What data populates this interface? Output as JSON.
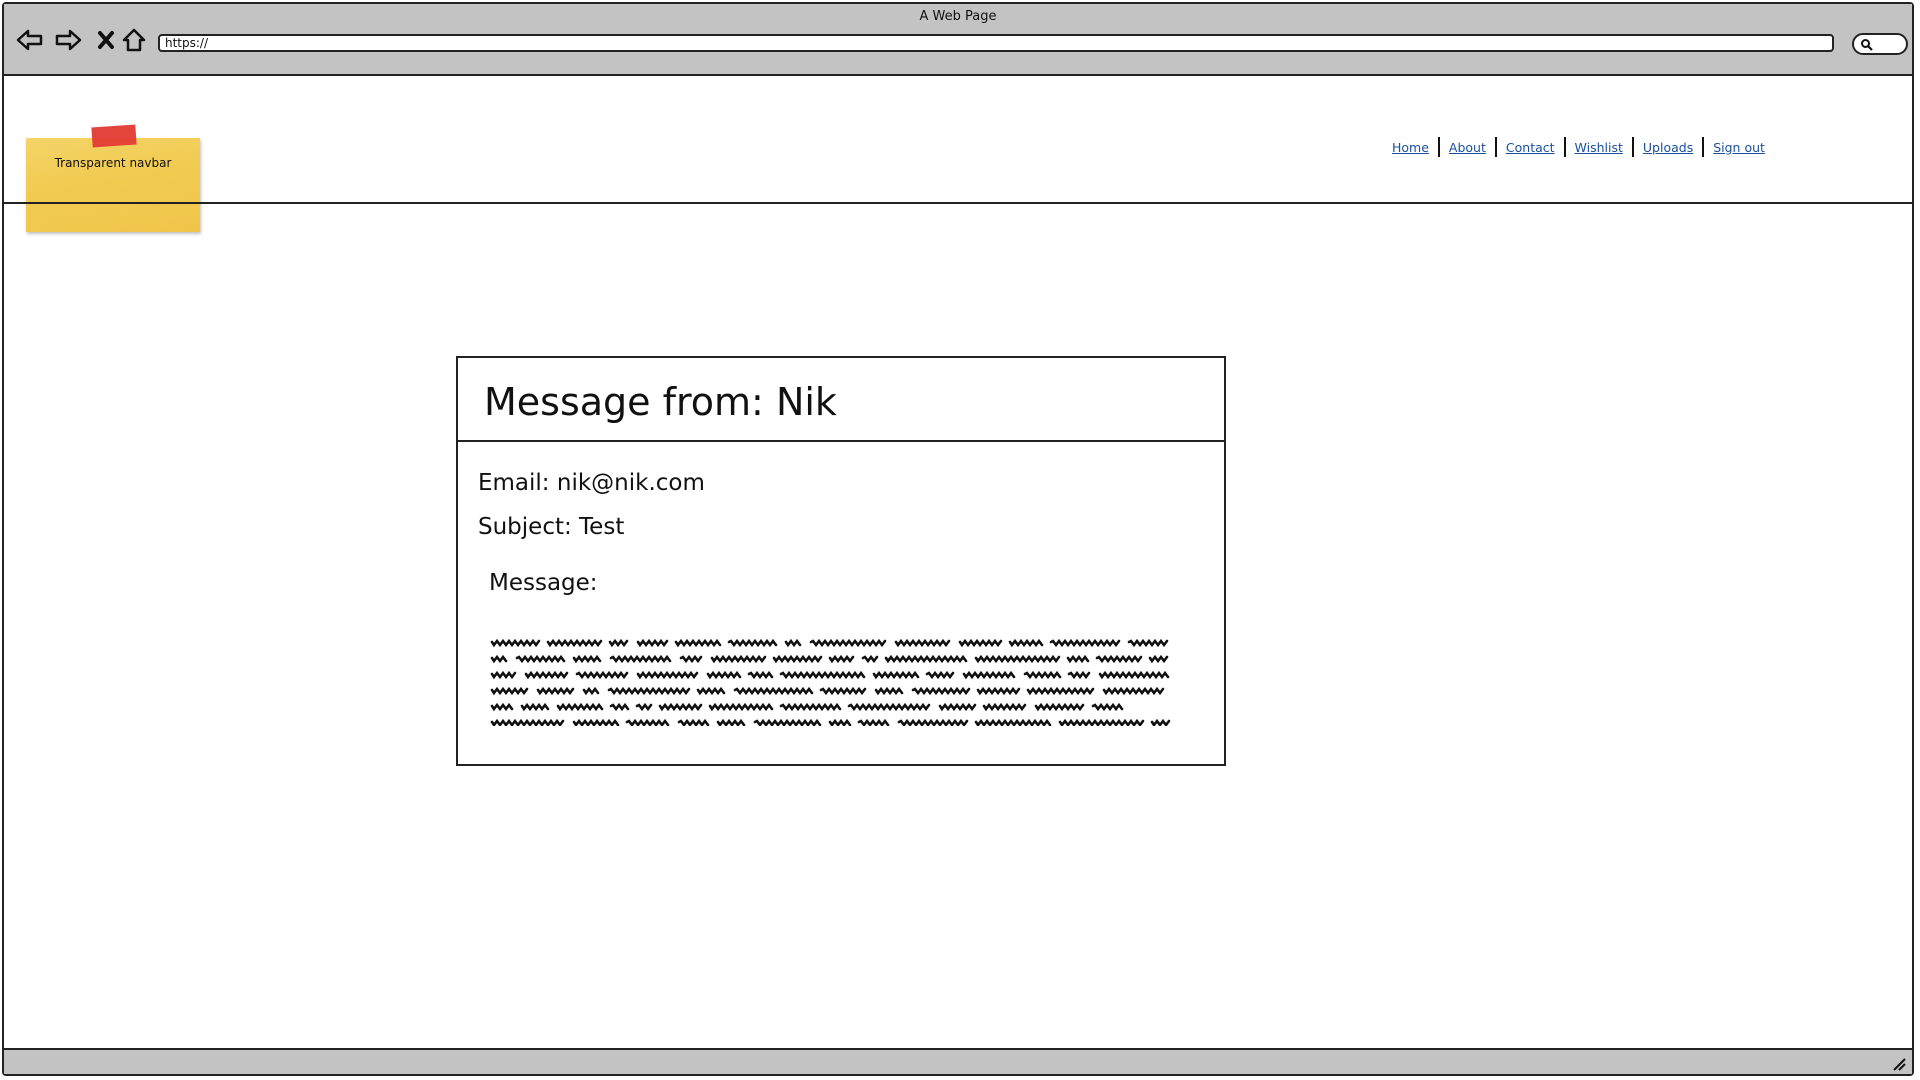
{
  "window": {
    "title": "A Web Page"
  },
  "browser": {
    "address": "https://",
    "icons": {
      "back": "back-arrow-icon",
      "forward": "forward-arrow-icon",
      "stop": "close-icon",
      "home": "home-icon",
      "search": "search-icon"
    }
  },
  "brand": {
    "label": "Transparent navbar",
    "note_color": "#f1cb51",
    "tape_color": "#e23b31"
  },
  "nav": {
    "items": [
      "Home",
      "About",
      "Contact",
      "Wishlist",
      "Uploads",
      "Sign out"
    ],
    "link_color": "#1b4f9c"
  },
  "message": {
    "title": "Message from: Nik",
    "email": "Email: nik@nik.com",
    "subject": "Subject: Test",
    "label": "Message:"
  }
}
